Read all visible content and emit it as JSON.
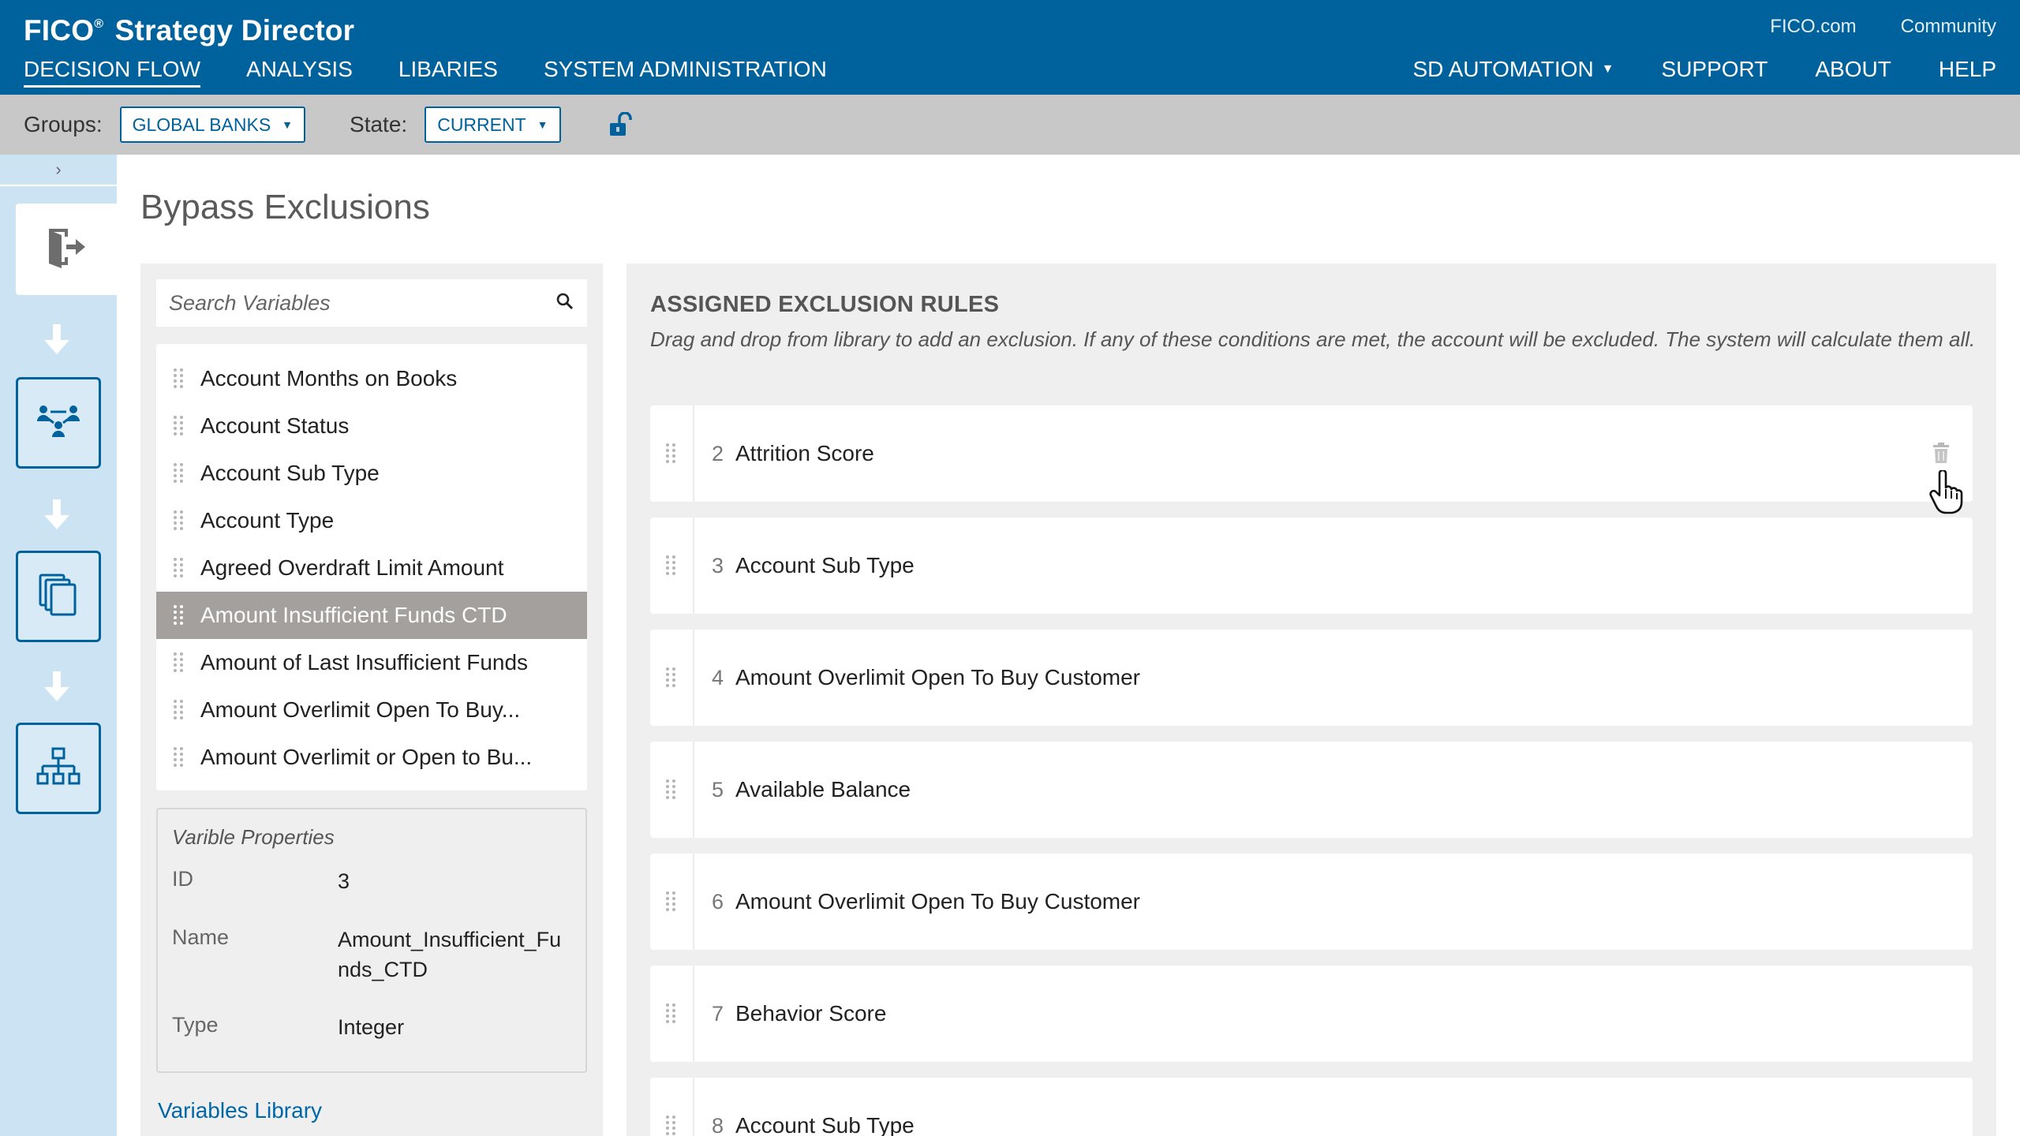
{
  "header": {
    "brand_name": "FICO",
    "brand_reg": "®",
    "brand_product": "Strategy Director",
    "util_links": [
      "FICO.com",
      "Community"
    ],
    "nav": [
      "DECISION FLOW",
      "ANALYSIS",
      "LIBARIES",
      "SYSTEM ADMINISTRATION"
    ],
    "right_nav": {
      "account": "SD AUTOMATION",
      "support": "SUPPORT",
      "about": "ABOUT",
      "help": "HELP"
    }
  },
  "filters": {
    "groups_label": "Groups:",
    "groups_value": "GLOBAL BANKS",
    "state_label": "State:",
    "state_value": "CURRENT"
  },
  "rail": {
    "toggle": "›",
    "steps": [
      "exit-icon",
      "people-network-icon",
      "documents-icon",
      "hierarchy-icon"
    ]
  },
  "page": {
    "title": "Bypass Exclusions"
  },
  "variables": {
    "search_placeholder": "Search Variables",
    "items": [
      "Account Months on Books",
      "Account Status",
      "Account Sub Type",
      "Account Type",
      "Agreed Overdraft Limit Amount",
      "Amount Insufficient Funds CTD",
      "Amount of Last Insufficient Funds",
      "Amount Overlimit Open To Buy...",
      "Amount Overlimit or Open to Bu..."
    ],
    "selected_index": 5,
    "properties": {
      "title": "Varible Properties",
      "id_label": "ID",
      "id_value": "3",
      "name_label": "Name",
      "name_value": "Amount_Insufficient_Funds_CTD",
      "type_label": "Type",
      "type_value": "Integer"
    },
    "library_link": "Variables Library"
  },
  "rules": {
    "title": "ASSIGNED EXCLUSION RULES",
    "description": "Drag and drop from library to add an exclusion. If any of these conditions are met, the account will be excluded. The system will calculate them all.",
    "items": [
      {
        "num": "2",
        "name": "Attrition Score"
      },
      {
        "num": "3",
        "name": "Account Sub Type"
      },
      {
        "num": "4",
        "name": "Amount Overlimit Open To Buy Customer"
      },
      {
        "num": "5",
        "name": "Available Balance"
      },
      {
        "num": "6",
        "name": "Amount Overlimit Open To Buy Customer"
      },
      {
        "num": "7",
        "name": "Behavior Score"
      },
      {
        "num": "8",
        "name": "Account Sub Type"
      }
    ]
  },
  "colors": {
    "brand_blue": "#00629d",
    "filter_bar": "#c8c8c8",
    "rail_bg": "#cbe3f3",
    "selected_row": "#a3a09d",
    "panel_bg": "#efefef"
  }
}
